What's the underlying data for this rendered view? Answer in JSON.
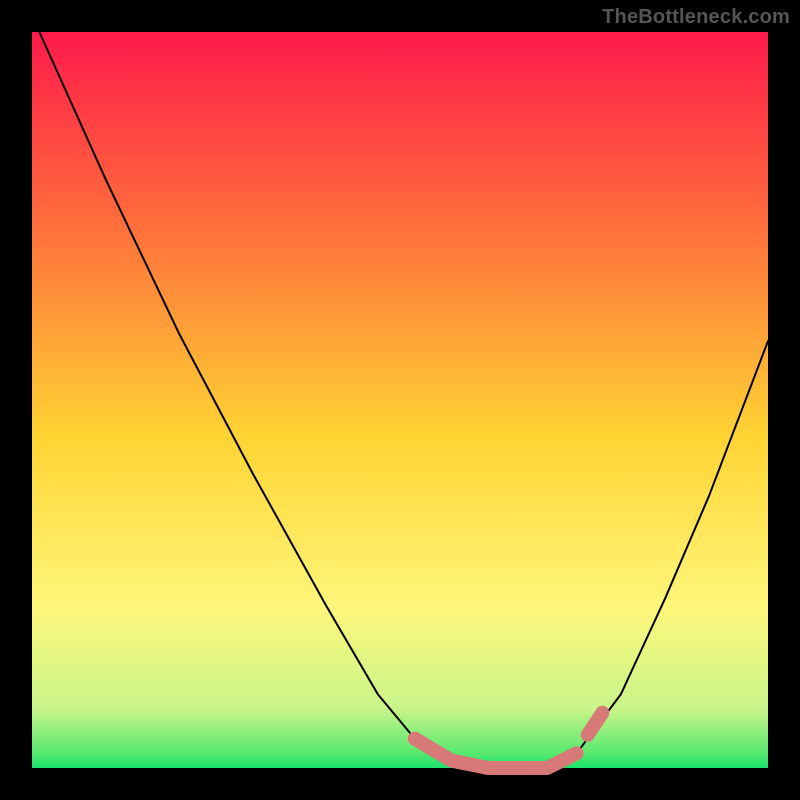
{
  "attribution": "TheBottleneck.com",
  "chart_data": {
    "type": "line",
    "title": "",
    "xlabel": "",
    "ylabel": "",
    "xlim": [
      0,
      100
    ],
    "ylim": [
      0,
      100
    ],
    "legend": false,
    "grid": false,
    "background": "rainbow-vertical-gradient (red→orange→yellow→green)",
    "annotation_band_color": "#d77a77",
    "series": [
      {
        "name": "bottleneck-curve",
        "x": [
          1,
          10,
          20,
          30,
          40,
          47,
          52,
          57,
          62,
          67,
          70,
          74,
          80,
          86,
          92,
          100
        ],
        "values": [
          100,
          80,
          59,
          40,
          22,
          10,
          4,
          1,
          0,
          0,
          0,
          2,
          10,
          23,
          37,
          58
        ]
      }
    ],
    "annotation_band": {
      "name": "highlighted-flat-region",
      "x": [
        52,
        57,
        62,
        67,
        70,
        74
      ],
      "values": [
        4,
        1,
        0,
        0,
        0,
        2
      ]
    },
    "colors": {
      "curve": "#000000",
      "band": "#d77a77",
      "gradient": [
        "#ff1a4b",
        "#ff6a3c",
        "#ffd433",
        "#fff67a",
        "#7ef06e",
        "#19e36e"
      ]
    }
  }
}
